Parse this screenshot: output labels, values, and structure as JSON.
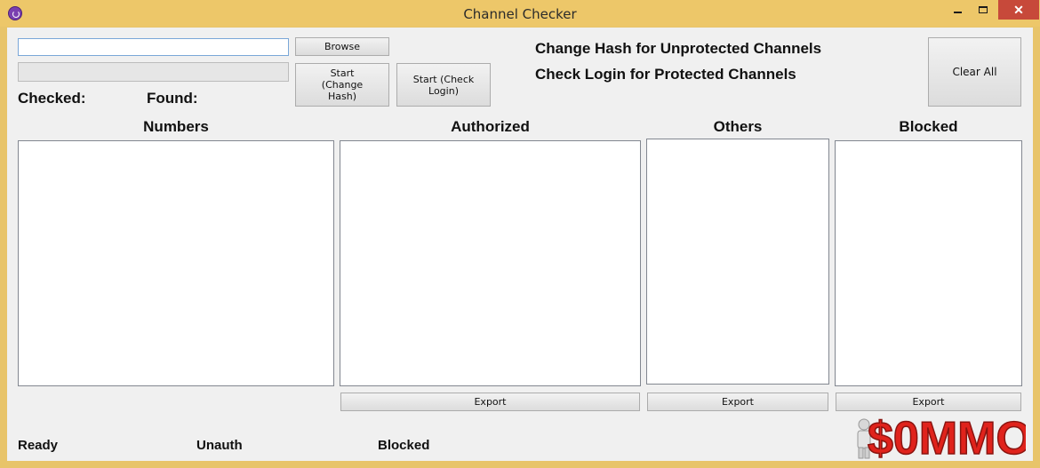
{
  "window": {
    "title": "Channel Checker",
    "close_glyph": "✕"
  },
  "inputs": {
    "file_path_value": "",
    "browse_label": "Browse",
    "start_change_hash_label": "Start (Change Hash)",
    "start_check_login_label": "Start (Check Login)",
    "clear_all_label": "Clear All"
  },
  "progress": {
    "value": 0
  },
  "counters": {
    "checked_label": "Checked:",
    "found_label": "Found:"
  },
  "info": {
    "line1": "Change Hash for Unprotected Channels",
    "line2": "Check Login for Protected Channels"
  },
  "lists": {
    "numbers_header": "Numbers",
    "authorized_header": "Authorized",
    "others_header": "Others",
    "blocked_header": "Blocked",
    "export_label": "Export"
  },
  "status_bar": {
    "ready": "Ready",
    "unauth": "Unauth",
    "blocked": "Blocked"
  },
  "watermark": {
    "text": "$0MMO"
  },
  "colors": {
    "titlebar": "#edc769",
    "close_button": "#c7493a",
    "client_bg": "#f0f0f0",
    "watermark_red": "#e0231c"
  }
}
